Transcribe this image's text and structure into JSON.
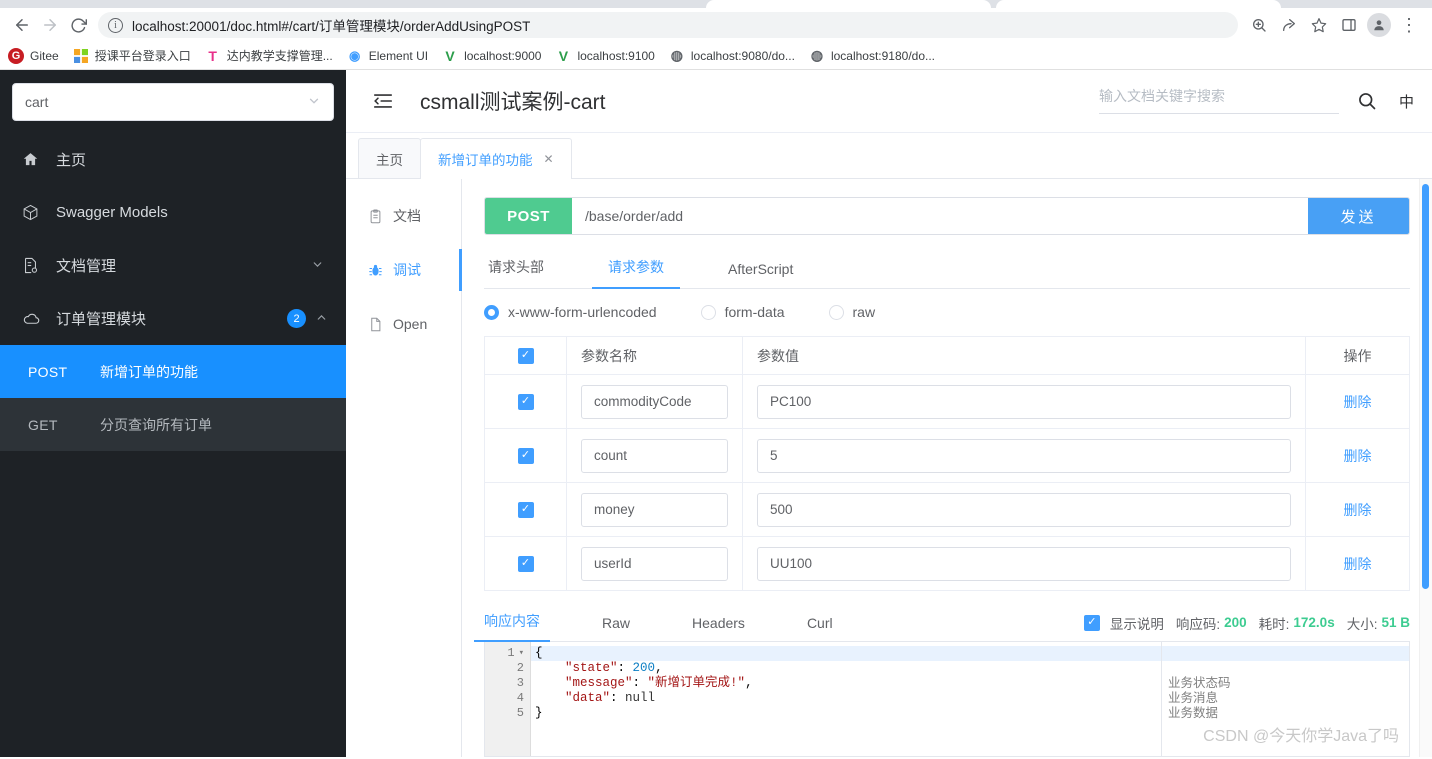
{
  "browser": {
    "nav": {
      "back": "←",
      "forward": "→",
      "reload": "↻"
    },
    "url": "localhost:20001/doc.html#/cart/订单管理模块/orderAddUsingPOST",
    "icons": {
      "info": "ⓘ",
      "zoom": "zoom-icon",
      "share": "share-icon",
      "star": "star-icon",
      "sidepanel": "side-panel-icon",
      "avatar": "avatar-icon",
      "menu": "⋮"
    },
    "bookmarks": [
      {
        "label": "Gitee",
        "glyph": "G",
        "bg": "#c71d23",
        "fg": "#ffffff"
      },
      {
        "label": "授课平台登录入口",
        "glyph": "▒",
        "bg": "#ffffff",
        "fg": "#f5a623"
      },
      {
        "label": "达内教学支撑管理...",
        "glyph": "T",
        "bg": "#ffffff",
        "fg": "#e8308a"
      },
      {
        "label": "Element UI",
        "glyph": "◉",
        "bg": "#ffffff",
        "fg": "#409eff"
      },
      {
        "label": "localhost:9000",
        "glyph": "V",
        "bg": "#ffffff",
        "fg": "#2c9e4b"
      },
      {
        "label": "localhost:9100",
        "glyph": "V",
        "bg": "#ffffff",
        "fg": "#2c9e4b"
      },
      {
        "label": "localhost:9080/do...",
        "glyph": "◔",
        "bg": "#ffffff",
        "fg": "#5f6368"
      },
      {
        "label": "localhost:9180/do...",
        "glyph": "◔",
        "bg": "#ffffff",
        "fg": "#5f6368"
      }
    ]
  },
  "sidebar": {
    "project": {
      "value": "cart",
      "chevron": "⌄"
    },
    "nav": [
      {
        "name": "home",
        "label": "主页",
        "icon": "home-icon",
        "chevron": "",
        "badge": ""
      },
      {
        "name": "swagger-models",
        "label": "Swagger Models",
        "icon": "cube-icon",
        "chevron": "",
        "badge": ""
      },
      {
        "name": "doc-manage",
        "label": "文档管理",
        "icon": "document-settings-icon",
        "chevron": "⌄",
        "badge": ""
      },
      {
        "name": "order-module",
        "label": "订单管理模块",
        "icon": "cloud-icon",
        "chevron": "⌃",
        "badge": "2"
      }
    ],
    "apis": [
      {
        "method": "POST",
        "label": "新增订单的功能",
        "active": true
      },
      {
        "method": "GET",
        "label": "分页查询所有订单",
        "active": false
      }
    ]
  },
  "header": {
    "collapse_icon": "collapse-menu-icon",
    "title": "csmall测试案例-cart",
    "search_placeholder": "输入文档关键字搜索",
    "search_value": "",
    "search_icon": "search-icon",
    "lang": "中"
  },
  "doc_tabs": [
    {
      "label": "主页",
      "active": false,
      "closable": false
    },
    {
      "label": "新增订单的功能",
      "active": true,
      "closable": true,
      "close": "✕"
    }
  ],
  "left_nav": [
    {
      "label": "文档",
      "icon": "clipboard-icon",
      "active": false
    },
    {
      "label": "调试",
      "icon": "bug-icon",
      "active": true
    },
    {
      "label": "Open",
      "icon": "file-icon",
      "active": false
    }
  ],
  "request": {
    "method": "POST",
    "method_color": "#4fcb90",
    "url": "/base/order/add",
    "url_placeholder": "",
    "send_label": "发送",
    "send_color": "#48a0f5",
    "tabs": [
      {
        "label": "请求头部",
        "active": false
      },
      {
        "label": "请求参数",
        "active": true
      },
      {
        "label": "AfterScript",
        "active": false
      }
    ],
    "body_types": [
      {
        "label": "x-www-form-urlencoded",
        "selected": true
      },
      {
        "label": "form-data",
        "selected": false
      },
      {
        "label": "raw",
        "selected": false
      }
    ],
    "table": {
      "headers": {
        "name": "参数名称",
        "value": "参数值",
        "op": "操作"
      },
      "header_checked": true,
      "rows": [
        {
          "checked": true,
          "name": "commodityCode",
          "value": "PC100",
          "op": "删除"
        },
        {
          "checked": true,
          "name": "count",
          "value": "5",
          "op": "删除"
        },
        {
          "checked": true,
          "name": "money",
          "value": "500",
          "op": "删除"
        },
        {
          "checked": true,
          "name": "userId",
          "value": "UU100",
          "op": "删除"
        }
      ]
    }
  },
  "response": {
    "tabs": [
      {
        "label": "响应内容",
        "active": true
      },
      {
        "label": "Raw",
        "active": false
      },
      {
        "label": "Headers",
        "active": false
      },
      {
        "label": "Curl",
        "active": false
      }
    ],
    "show_desc_checked": true,
    "show_desc_label": "显示说明",
    "status_label": "响应码:",
    "status_value": "200",
    "time_label": "耗时:",
    "time_value": "172.0s",
    "size_label": "大小:",
    "size_value": "51 B",
    "value_color": "#3dcc91",
    "code_lines": [
      {
        "n": "1",
        "text": "{",
        "highlight": true,
        "fold": "▾"
      },
      {
        "n": "2",
        "text": "    \"state\": 200,",
        "highlight": false,
        "fold": ""
      },
      {
        "n": "3",
        "text": "    \"message\": \"新增订单完成!\",",
        "highlight": false,
        "fold": ""
      },
      {
        "n": "4",
        "text": "    \"data\": null",
        "highlight": false,
        "fold": ""
      },
      {
        "n": "5",
        "text": "}",
        "highlight": false,
        "fold": ""
      }
    ],
    "annotations": [
      "",
      "业务状态码",
      "业务消息",
      "业务数据",
      ""
    ]
  },
  "watermark": "CSDN @今天你学Java了吗"
}
